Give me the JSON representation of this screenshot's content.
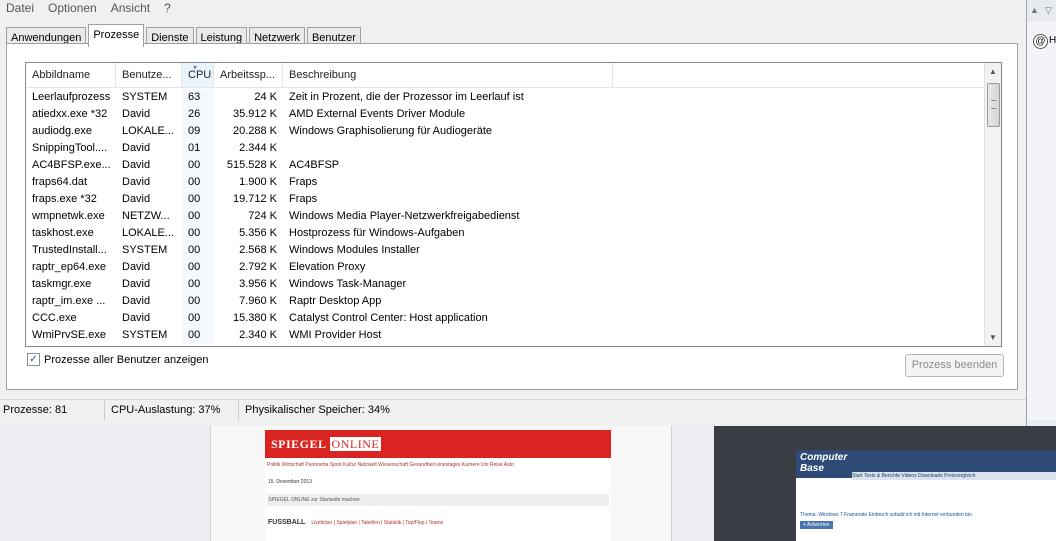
{
  "menu": [
    "Datei",
    "Optionen",
    "Ansicht",
    "?"
  ],
  "tabs": [
    {
      "label": "Anwendungen",
      "active": false
    },
    {
      "label": "Prozesse",
      "active": true
    },
    {
      "label": "Dienste",
      "active": false
    },
    {
      "label": "Leistung",
      "active": false
    },
    {
      "label": "Netzwerk",
      "active": false
    },
    {
      "label": "Benutzer",
      "active": false
    }
  ],
  "columns": {
    "image": "Abbildname",
    "user": "Benutze...",
    "cpu": "CPU",
    "memory": "Arbeitssp...",
    "description": "Beschreibung"
  },
  "processes": [
    {
      "name": "Leerlaufprozess",
      "user": "SYSTEM",
      "cpu": "63",
      "mem": "24 K",
      "desc": "Zeit in Prozent, die der Prozessor im Leerlauf ist"
    },
    {
      "name": "atiedxx.exe *32",
      "user": "David",
      "cpu": "26",
      "mem": "35.912 K",
      "desc": "AMD External Events Driver Module"
    },
    {
      "name": "audiodg.exe",
      "user": "LOKALE...",
      "cpu": "09",
      "mem": "20.288 K",
      "desc": "Windows Graphisolierung für Audiogeräte"
    },
    {
      "name": "SnippingTool....",
      "user": "David",
      "cpu": "01",
      "mem": "2.344 K",
      "desc": ""
    },
    {
      "name": "AC4BFSP.exe...",
      "user": "David",
      "cpu": "00",
      "mem": "515.528 K",
      "desc": "AC4BFSP"
    },
    {
      "name": "fraps64.dat",
      "user": "David",
      "cpu": "00",
      "mem": "1.900 K",
      "desc": "Fraps"
    },
    {
      "name": "fraps.exe *32",
      "user": "David",
      "cpu": "00",
      "mem": "19.712 K",
      "desc": "Fraps"
    },
    {
      "name": "wmpnetwk.exe",
      "user": "NETZW...",
      "cpu": "00",
      "mem": "724 K",
      "desc": "Windows Media Player-Netzwerkfreigabedienst"
    },
    {
      "name": "taskhost.exe",
      "user": "LOKALE...",
      "cpu": "00",
      "mem": "5.356 K",
      "desc": "Hostprozess für Windows-Aufgaben"
    },
    {
      "name": "TrustedInstall...",
      "user": "SYSTEM",
      "cpu": "00",
      "mem": "2.568 K",
      "desc": "Windows Modules Installer"
    },
    {
      "name": "raptr_ep64.exe",
      "user": "David",
      "cpu": "00",
      "mem": "2.792 K",
      "desc": "Elevation Proxy"
    },
    {
      "name": "taskmgr.exe",
      "user": "David",
      "cpu": "00",
      "mem": "3.956 K",
      "desc": "Windows Task-Manager"
    },
    {
      "name": "raptr_im.exe ...",
      "user": "David",
      "cpu": "00",
      "mem": "7.960 K",
      "desc": "Raptr Desktop App"
    },
    {
      "name": "CCC.exe",
      "user": "David",
      "cpu": "00",
      "mem": "15.380 K",
      "desc": "Catalyst Control Center: Host application"
    },
    {
      "name": "WmiPrvSE.exe",
      "user": "SYSTEM",
      "cpu": "00",
      "mem": "2.340 K",
      "desc": "WMI Provider Host"
    }
  ],
  "show_all_users": {
    "label": "Prozesse aller Benutzer anzeigen",
    "checked": true
  },
  "end_process_label": "Prozess beenden",
  "status": {
    "processes": "Prozesse: 81",
    "cpu": "CPU-Auslastung: 37%",
    "memory": "Physikalischer Speicher: 34%"
  },
  "background": {
    "right_strip_text": "H",
    "spiegel": {
      "logo_a": "SPIEGEL",
      "logo_b": "ONLINE",
      "nav": "Politik Wirtschaft Panorama Sport Kultur Netzwelt Wissenschaft Gesundheit einestages Karriere Uni Reise Auto",
      "date": "15. Dezember 2013",
      "bar": "SPIEGEL ONLINE zur Startseite machen",
      "section": "FUSSBALL",
      "section_links": "Liveticker | Spielplan | Tabellen | Statistik | Top/Flop | Teams"
    },
    "computerbase": {
      "logo_a": "Computer",
      "logo_b": "Base",
      "nav": "Start  Tests & Berichte  Videos  Downloads  Preisvergleich",
      "thema": "Thema: Windows 7 Framerate Einbruch sobald ich mit Internet verbunden bin",
      "button": "+ Antworten"
    }
  },
  "colors": {
    "accent": "#3399ff",
    "window_bg": "#f0f0f0",
    "spiegel_red": "#d92421",
    "computerbase_blue": "#2e4a76"
  }
}
